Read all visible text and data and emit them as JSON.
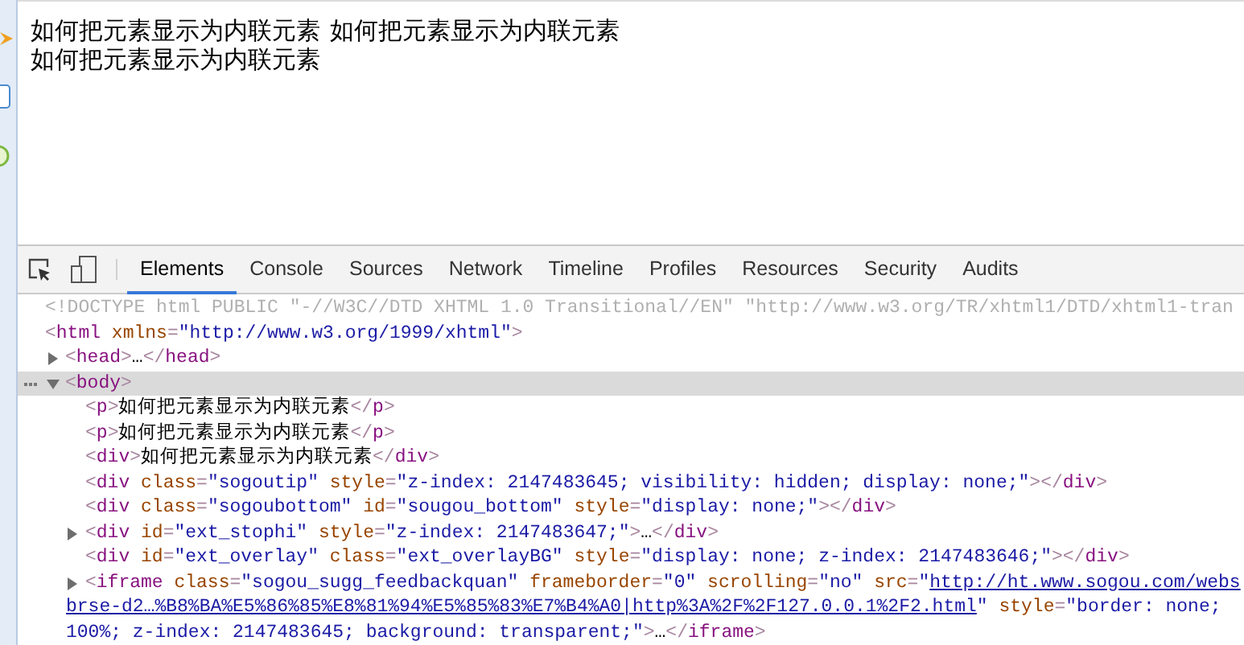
{
  "page": {
    "lines": [
      [
        "如何把元素显示为内联元素",
        "如何把元素显示为内联元素"
      ],
      [
        "如何把元素显示为内联元素"
      ]
    ]
  },
  "devtools": {
    "tabs": [
      {
        "label": "Elements",
        "selected": true
      },
      {
        "label": "Console",
        "selected": false
      },
      {
        "label": "Sources",
        "selected": false
      },
      {
        "label": "Network",
        "selected": false
      },
      {
        "label": "Timeline",
        "selected": false
      },
      {
        "label": "Profiles",
        "selected": false
      },
      {
        "label": "Resources",
        "selected": false
      },
      {
        "label": "Security",
        "selected": false
      },
      {
        "label": "Audits",
        "selected": false
      }
    ],
    "dom_tree": [
      {
        "selected": false,
        "tokens": [
          {
            "kind": "doctype",
            "text": "<!DOCTYPE html PUBLIC \"-//W3C//DTD XHTML 1.0 Transitional//EN\" \"http://www.w3.org/TR/xhtml1/DTD/xhtml1-tran"
          }
        ]
      },
      {
        "selected": false,
        "tokens": [
          {
            "kind": "bracket",
            "text": "<"
          },
          {
            "kind": "tag",
            "text": "html"
          },
          {
            "kind": "attr",
            "text": " xmlns"
          },
          {
            "kind": "bracket",
            "text": "="
          },
          {
            "kind": "value",
            "text": "\"http://www.w3.org/1999/xhtml\""
          },
          {
            "kind": "bracket",
            "text": ">"
          }
        ],
        "children": [
          {
            "selected": false,
            "expanded": false,
            "tokens": [
              {
                "kind": "bracket",
                "text": "<"
              },
              {
                "kind": "tag",
                "text": "head"
              },
              {
                "kind": "bracket",
                "text": ">"
              },
              {
                "kind": "text",
                "text": "…"
              },
              {
                "kind": "bracket",
                "text": "</"
              },
              {
                "kind": "tag",
                "text": "head"
              },
              {
                "kind": "bracket",
                "text": ">"
              }
            ]
          },
          {
            "selected": true,
            "expanded": true,
            "tokens": [
              {
                "kind": "bracket",
                "text": "<"
              },
              {
                "kind": "tag",
                "text": "body"
              },
              {
                "kind": "bracket",
                "text": ">"
              }
            ],
            "children": [
              {
                "selected": false,
                "tokens": [
                  {
                    "kind": "bracket",
                    "text": "<"
                  },
                  {
                    "kind": "tag",
                    "text": "p"
                  },
                  {
                    "kind": "bracket",
                    "text": ">"
                  },
                  {
                    "kind": "text",
                    "text": "如何把元素显示为内联元素"
                  },
                  {
                    "kind": "bracket",
                    "text": "</"
                  },
                  {
                    "kind": "tag",
                    "text": "p"
                  },
                  {
                    "kind": "bracket",
                    "text": ">"
                  }
                ]
              },
              {
                "selected": false,
                "tokens": [
                  {
                    "kind": "bracket",
                    "text": "<"
                  },
                  {
                    "kind": "tag",
                    "text": "p"
                  },
                  {
                    "kind": "bracket",
                    "text": ">"
                  },
                  {
                    "kind": "text",
                    "text": "如何把元素显示为内联元素"
                  },
                  {
                    "kind": "bracket",
                    "text": "</"
                  },
                  {
                    "kind": "tag",
                    "text": "p"
                  },
                  {
                    "kind": "bracket",
                    "text": ">"
                  }
                ]
              },
              {
                "selected": false,
                "tokens": [
                  {
                    "kind": "bracket",
                    "text": "<"
                  },
                  {
                    "kind": "tag",
                    "text": "div"
                  },
                  {
                    "kind": "bracket",
                    "text": ">"
                  },
                  {
                    "kind": "text",
                    "text": "如何把元素显示为内联元素"
                  },
                  {
                    "kind": "bracket",
                    "text": "</"
                  },
                  {
                    "kind": "tag",
                    "text": "div"
                  },
                  {
                    "kind": "bracket",
                    "text": ">"
                  }
                ]
              },
              {
                "selected": false,
                "tokens": [
                  {
                    "kind": "bracket",
                    "text": "<"
                  },
                  {
                    "kind": "tag",
                    "text": "div"
                  },
                  {
                    "kind": "attr",
                    "text": " class"
                  },
                  {
                    "kind": "bracket",
                    "text": "="
                  },
                  {
                    "kind": "value",
                    "text": "\"sogoutip\""
                  },
                  {
                    "kind": "attr",
                    "text": " style"
                  },
                  {
                    "kind": "bracket",
                    "text": "="
                  },
                  {
                    "kind": "value",
                    "text": "\"z-index: 2147483645; visibility: hidden; display: none;\""
                  },
                  {
                    "kind": "bracket",
                    "text": "></"
                  },
                  {
                    "kind": "tag",
                    "text": "div"
                  },
                  {
                    "kind": "bracket",
                    "text": ">"
                  }
                ]
              },
              {
                "selected": false,
                "tokens": [
                  {
                    "kind": "bracket",
                    "text": "<"
                  },
                  {
                    "kind": "tag",
                    "text": "div"
                  },
                  {
                    "kind": "attr",
                    "text": " class"
                  },
                  {
                    "kind": "bracket",
                    "text": "="
                  },
                  {
                    "kind": "value",
                    "text": "\"sogoubottom\""
                  },
                  {
                    "kind": "attr",
                    "text": " id"
                  },
                  {
                    "kind": "bracket",
                    "text": "="
                  },
                  {
                    "kind": "value",
                    "text": "\"sougou_bottom\""
                  },
                  {
                    "kind": "attr",
                    "text": " style"
                  },
                  {
                    "kind": "bracket",
                    "text": "="
                  },
                  {
                    "kind": "value",
                    "text": "\"display: none;\""
                  },
                  {
                    "kind": "bracket",
                    "text": "></"
                  },
                  {
                    "kind": "tag",
                    "text": "div"
                  },
                  {
                    "kind": "bracket",
                    "text": ">"
                  }
                ]
              },
              {
                "selected": false,
                "expanded": false,
                "tokens": [
                  {
                    "kind": "bracket",
                    "text": "<"
                  },
                  {
                    "kind": "tag",
                    "text": "div"
                  },
                  {
                    "kind": "attr",
                    "text": " id"
                  },
                  {
                    "kind": "bracket",
                    "text": "="
                  },
                  {
                    "kind": "value",
                    "text": "\"ext_stophi\""
                  },
                  {
                    "kind": "attr",
                    "text": " style"
                  },
                  {
                    "kind": "bracket",
                    "text": "="
                  },
                  {
                    "kind": "value",
                    "text": "\"z-index: 2147483647;\""
                  },
                  {
                    "kind": "bracket",
                    "text": ">"
                  },
                  {
                    "kind": "text",
                    "text": "…"
                  },
                  {
                    "kind": "bracket",
                    "text": "</"
                  },
                  {
                    "kind": "tag",
                    "text": "div"
                  },
                  {
                    "kind": "bracket",
                    "text": ">"
                  }
                ]
              },
              {
                "selected": false,
                "tokens": [
                  {
                    "kind": "bracket",
                    "text": "<"
                  },
                  {
                    "kind": "tag",
                    "text": "div"
                  },
                  {
                    "kind": "attr",
                    "text": " id"
                  },
                  {
                    "kind": "bracket",
                    "text": "="
                  },
                  {
                    "kind": "value",
                    "text": "\"ext_overlay\""
                  },
                  {
                    "kind": "attr",
                    "text": " class"
                  },
                  {
                    "kind": "bracket",
                    "text": "="
                  },
                  {
                    "kind": "value",
                    "text": "\"ext_overlayBG\""
                  },
                  {
                    "kind": "attr",
                    "text": " style"
                  },
                  {
                    "kind": "bracket",
                    "text": "="
                  },
                  {
                    "kind": "value",
                    "text": "\"display: none; z-index: 2147483646;\""
                  },
                  {
                    "kind": "bracket",
                    "text": "></"
                  },
                  {
                    "kind": "tag",
                    "text": "div"
                  },
                  {
                    "kind": "bracket",
                    "text": ">"
                  }
                ]
              },
              {
                "selected": false,
                "expanded": false,
                "tokens": [
                  {
                    "kind": "bracket",
                    "text": "<"
                  },
                  {
                    "kind": "tag",
                    "text": "iframe"
                  },
                  {
                    "kind": "attr",
                    "text": " class"
                  },
                  {
                    "kind": "bracket",
                    "text": "="
                  },
                  {
                    "kind": "value",
                    "text": "\"sogou_sugg_feedbackquan\""
                  },
                  {
                    "kind": "attr",
                    "text": " frameborder"
                  },
                  {
                    "kind": "bracket",
                    "text": "="
                  },
                  {
                    "kind": "value",
                    "text": "\"0\""
                  },
                  {
                    "kind": "attr",
                    "text": " scrolling"
                  },
                  {
                    "kind": "bracket",
                    "text": "="
                  },
                  {
                    "kind": "value",
                    "text": "\"no\""
                  },
                  {
                    "kind": "attr",
                    "text": " src"
                  },
                  {
                    "kind": "bracket",
                    "text": "="
                  },
                  {
                    "kind": "value",
                    "text": "\""
                  },
                  {
                    "kind": "link",
                    "text": "http://ht.www.sogou.com/webs"
                  },
                  {
                    "kind": "link",
                    "text": "brse-d2…%B8%BA%E5%86%85%E8%81%94%E5%85%83%E7%B4%A0|http%3A%2F%2F127.0.0.1%2F2.html",
                    "wrap_before": true
                  },
                  {
                    "kind": "value",
                    "text": "\""
                  },
                  {
                    "kind": "attr",
                    "text": " style"
                  },
                  {
                    "kind": "bracket",
                    "text": "="
                  },
                  {
                    "kind": "value",
                    "text": "\"border: none;"
                  },
                  {
                    "kind": "value",
                    "text": "100%; z-index: 2147483645; background: transparent;\"",
                    "wrap_before": true
                  },
                  {
                    "kind": "bracket",
                    "text": ">"
                  },
                  {
                    "kind": "text",
                    "text": "…"
                  },
                  {
                    "kind": "bracket",
                    "text": "</"
                  },
                  {
                    "kind": "tag",
                    "text": "iframe"
                  },
                  {
                    "kind": "bracket",
                    "text": ">"
                  }
                ]
              }
            ]
          }
        ]
      }
    ]
  }
}
